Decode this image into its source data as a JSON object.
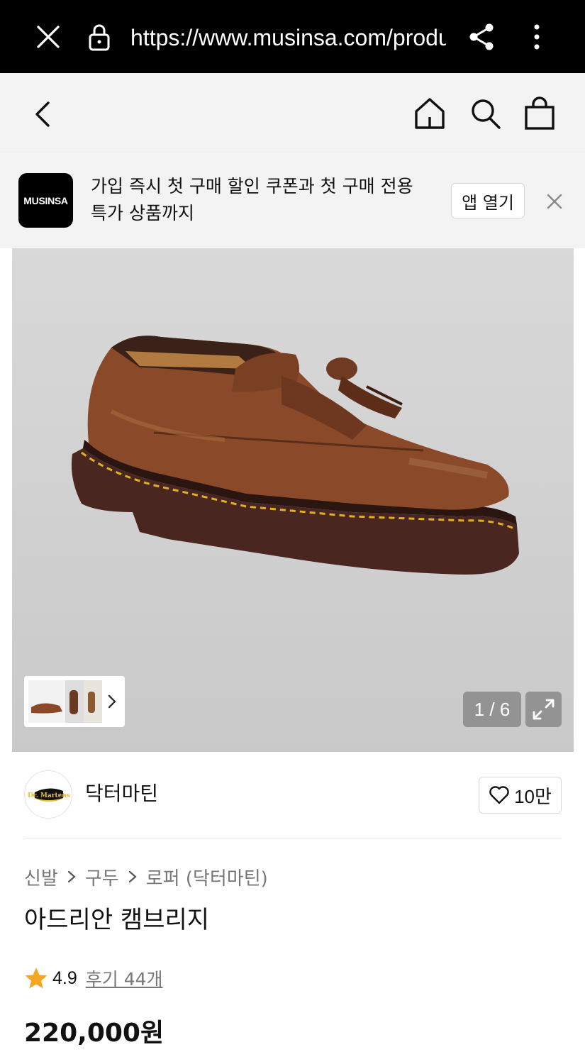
{
  "browser": {
    "url": "https://www.musinsa.com/products/",
    "icons": [
      "close-icon",
      "lock-icon",
      "share-icon",
      "more-vertical-icon"
    ]
  },
  "header": {
    "icons": [
      "back-icon",
      "home-icon",
      "search-icon",
      "shopping-bag-icon"
    ]
  },
  "banner": {
    "logo_text": "MUSINSA",
    "message": "가입 즉시 첫 구매 할인 쿠폰과 첫 구매 전용 특가 상품까지",
    "open_app_label": "앱 열기"
  },
  "gallery": {
    "counter": "1 / 6",
    "background": "#d3d3d3"
  },
  "brand": {
    "name": "닥터마틴",
    "logo_text": "Dr. Martens",
    "like_count": "10만"
  },
  "breadcrumb": [
    "신발",
    "구두",
    "로퍼 (닥터마틴)"
  ],
  "product": {
    "title": "아드리안 캠브리지",
    "rating": "4.9",
    "review_label": "후기 44개",
    "price": "220,000원"
  },
  "colors": {
    "star": "#f5a623",
    "text": "#111111",
    "muted": "#777777"
  }
}
